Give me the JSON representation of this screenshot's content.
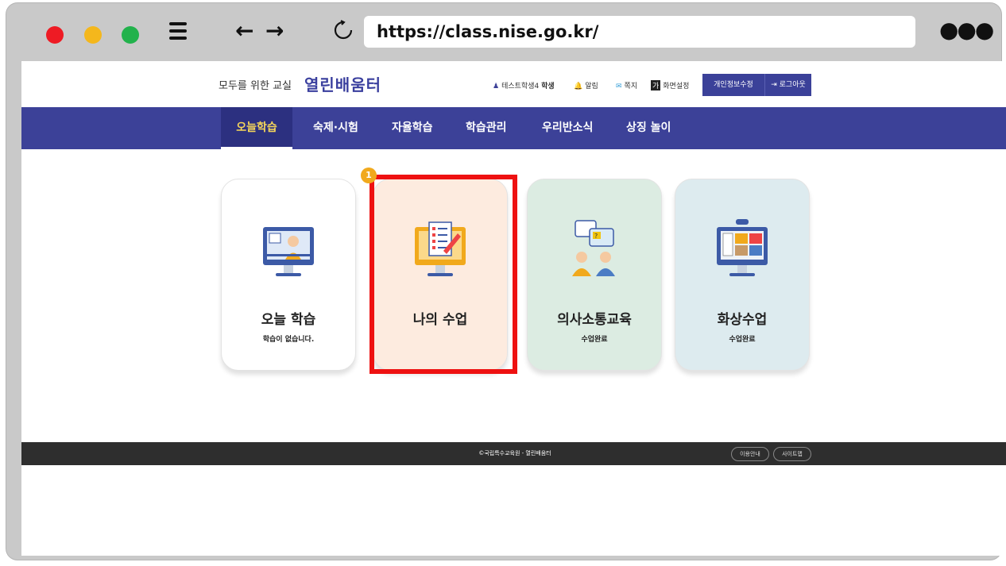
{
  "browser": {
    "url": "https://class.nise.go.kr/",
    "colors": {
      "close": "#ee1b24",
      "minimize": "#f4b71c",
      "maximize": "#22b24c"
    }
  },
  "header": {
    "brand_small": "모두를 위한 교실",
    "brand_big": "열린배움터",
    "user": "테스트학생4",
    "user_role": "학생",
    "alarm": "알림",
    "note": "쪽지",
    "screen_settings": "화면설정",
    "privacy_button": "개인정보수정",
    "logout_button": "로그아웃"
  },
  "nav": {
    "items": [
      {
        "label": "오늘학습"
      },
      {
        "label": "숙제·시험"
      },
      {
        "label": "자율학습"
      },
      {
        "label": "학습관리"
      },
      {
        "label": "우리반소식"
      },
      {
        "label": "상징 놀이"
      }
    ],
    "active_index": 0
  },
  "cards": [
    {
      "title": "오늘 학습",
      "subtitle": "학습이 없습니다.",
      "bg": "#ffffff"
    },
    {
      "title": "나의 수업",
      "subtitle": "",
      "bg": "#fdebdf"
    },
    {
      "title": "의사소통교육",
      "subtitle": "수업완료",
      "bg": "#dcece2"
    },
    {
      "title": "화상수업",
      "subtitle": "수업완료",
      "bg": "#ddebef"
    }
  ],
  "annotation": {
    "badge": "1"
  },
  "footer": {
    "copyright": "©국립특수교육원 - 열린배움터",
    "guide_button": "이용안내",
    "sitemap_button": "사이트맵"
  }
}
